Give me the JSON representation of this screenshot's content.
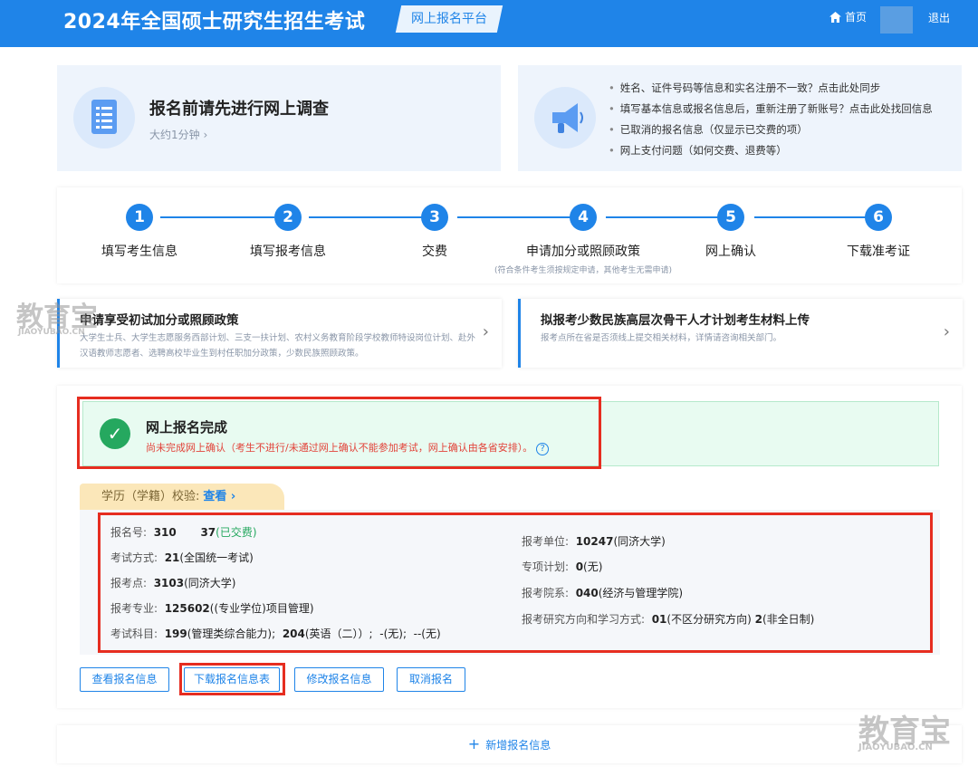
{
  "header": {
    "title": "2024年全国硕士研究生招生考试",
    "platform": "网上报名平台",
    "home": "首页",
    "logout": "退出",
    "color": "#1f84e8"
  },
  "survey": {
    "title": "报名前请先进行网上调查",
    "sub": "大约1分钟 ›"
  },
  "notices": [
    "姓名、证件号码等信息和实名注册不一致？点击此处同步",
    "填写基本信息或报名信息后，重新注册了新账号？点击此处找回信息",
    "已取消的报名信息（仅显示已交费的项）",
    "网上支付问题（如何交费、退费等）"
  ],
  "steps": [
    {
      "num": "1",
      "label": "填写考生信息",
      "sub": ""
    },
    {
      "num": "2",
      "label": "填写报考信息",
      "sub": ""
    },
    {
      "num": "3",
      "label": "交费",
      "sub": ""
    },
    {
      "num": "4",
      "label": "申请加分或照顾政策",
      "sub": "(符合条件考生须按规定申请，其他考生无需申请)"
    },
    {
      "num": "5",
      "label": "网上确认",
      "sub": ""
    },
    {
      "num": "6",
      "label": "下载准考证",
      "sub": ""
    }
  ],
  "policies": [
    {
      "title": "申请享受初试加分或照顾政策",
      "desc": "大学生士兵、大学生志愿服务西部计划、三支一扶计划、农村义务教育阶段学校教师特设岗位计划、赴外汉语教师志愿者、选聘高校毕业生到村任职加分政策，少数民族照顾政策。"
    },
    {
      "title": "拟报考少数民族高层次骨干人才计划考生材料上传",
      "desc": "报考点所在省是否须线上提交相关材料，详情请咨询相关部门。"
    }
  ],
  "watermark": {
    "brand": "教育宝",
    "site": "JIAOYUBAO.CN"
  },
  "status": {
    "title": "网上报名完成",
    "note": "尚未完成网上确认（考生不进行/未通过网上确认不能参加考试，网上确认由各省安排）。",
    "help": "?"
  },
  "education": {
    "label": "学历（学籍）校验:",
    "link": "查看 ›"
  },
  "registration": {
    "reg_no_label": "报名号:",
    "reg_no_a": "310",
    "reg_no_b": "37",
    "paid": "(已交费)",
    "exam_mode_label": "考试方式:",
    "exam_mode_code": "21",
    "exam_mode": "(全国统一考试)",
    "site_label": "报考点:",
    "site_code": "3103",
    "site": "(同济大学)",
    "major_label": "报考专业:",
    "major_code": "125602",
    "major": "((专业学位)项目管理)",
    "subjects_label": "考试科目:",
    "subj1_code": "199",
    "subj1": "(管理类综合能力);",
    "subj2_code": "204",
    "subj2": "(英语（二））;",
    "subj3": "-(无);",
    "subj4": "--(无)",
    "unit_label": "报考单位:",
    "unit_code": "10247",
    "unit": "(同济大学)",
    "plan_label": "专项计划:",
    "plan_code": "0",
    "plan": "(无)",
    "dept_label": "报考院系:",
    "dept_code": "040",
    "dept": "(经济与管理学院)",
    "direction_label": "报考研究方向和学习方式:",
    "direction_code": "01",
    "direction": "(不区分研究方向)",
    "mode_code": "2",
    "mode": "(非全日制)"
  },
  "actions": {
    "view": "查看报名信息",
    "download": "下载报名信息表",
    "edit": "修改报名信息",
    "cancel": "取消报名"
  },
  "add": {
    "label": "新增报名信息"
  }
}
